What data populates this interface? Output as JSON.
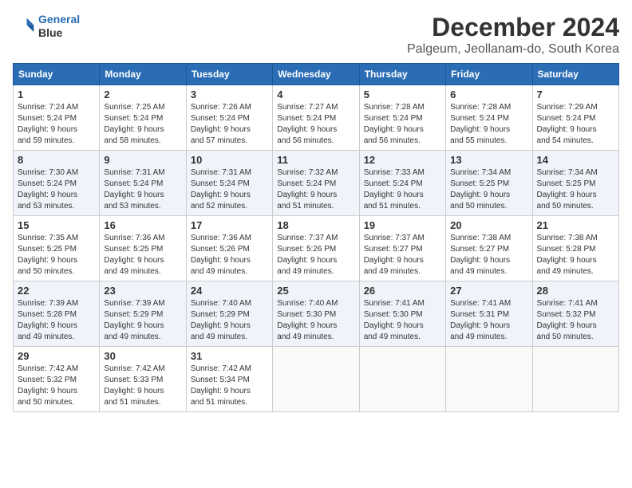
{
  "logo": {
    "line1": "General",
    "line2": "Blue"
  },
  "title": "December 2024",
  "subtitle": "Palgeum, Jeollanam-do, South Korea",
  "days_of_week": [
    "Sunday",
    "Monday",
    "Tuesday",
    "Wednesday",
    "Thursday",
    "Friday",
    "Saturday"
  ],
  "weeks": [
    [
      {
        "day": 1,
        "info": "Sunrise: 7:24 AM\nSunset: 5:24 PM\nDaylight: 9 hours\nand 59 minutes."
      },
      {
        "day": 2,
        "info": "Sunrise: 7:25 AM\nSunset: 5:24 PM\nDaylight: 9 hours\nand 58 minutes."
      },
      {
        "day": 3,
        "info": "Sunrise: 7:26 AM\nSunset: 5:24 PM\nDaylight: 9 hours\nand 57 minutes."
      },
      {
        "day": 4,
        "info": "Sunrise: 7:27 AM\nSunset: 5:24 PM\nDaylight: 9 hours\nand 56 minutes."
      },
      {
        "day": 5,
        "info": "Sunrise: 7:28 AM\nSunset: 5:24 PM\nDaylight: 9 hours\nand 56 minutes."
      },
      {
        "day": 6,
        "info": "Sunrise: 7:28 AM\nSunset: 5:24 PM\nDaylight: 9 hours\nand 55 minutes."
      },
      {
        "day": 7,
        "info": "Sunrise: 7:29 AM\nSunset: 5:24 PM\nDaylight: 9 hours\nand 54 minutes."
      }
    ],
    [
      {
        "day": 8,
        "info": "Sunrise: 7:30 AM\nSunset: 5:24 PM\nDaylight: 9 hours\nand 53 minutes."
      },
      {
        "day": 9,
        "info": "Sunrise: 7:31 AM\nSunset: 5:24 PM\nDaylight: 9 hours\nand 53 minutes."
      },
      {
        "day": 10,
        "info": "Sunrise: 7:31 AM\nSunset: 5:24 PM\nDaylight: 9 hours\nand 52 minutes."
      },
      {
        "day": 11,
        "info": "Sunrise: 7:32 AM\nSunset: 5:24 PM\nDaylight: 9 hours\nand 51 minutes."
      },
      {
        "day": 12,
        "info": "Sunrise: 7:33 AM\nSunset: 5:24 PM\nDaylight: 9 hours\nand 51 minutes."
      },
      {
        "day": 13,
        "info": "Sunrise: 7:34 AM\nSunset: 5:25 PM\nDaylight: 9 hours\nand 50 minutes."
      },
      {
        "day": 14,
        "info": "Sunrise: 7:34 AM\nSunset: 5:25 PM\nDaylight: 9 hours\nand 50 minutes."
      }
    ],
    [
      {
        "day": 15,
        "info": "Sunrise: 7:35 AM\nSunset: 5:25 PM\nDaylight: 9 hours\nand 50 minutes."
      },
      {
        "day": 16,
        "info": "Sunrise: 7:36 AM\nSunset: 5:25 PM\nDaylight: 9 hours\nand 49 minutes."
      },
      {
        "day": 17,
        "info": "Sunrise: 7:36 AM\nSunset: 5:26 PM\nDaylight: 9 hours\nand 49 minutes."
      },
      {
        "day": 18,
        "info": "Sunrise: 7:37 AM\nSunset: 5:26 PM\nDaylight: 9 hours\nand 49 minutes."
      },
      {
        "day": 19,
        "info": "Sunrise: 7:37 AM\nSunset: 5:27 PM\nDaylight: 9 hours\nand 49 minutes."
      },
      {
        "day": 20,
        "info": "Sunrise: 7:38 AM\nSunset: 5:27 PM\nDaylight: 9 hours\nand 49 minutes."
      },
      {
        "day": 21,
        "info": "Sunrise: 7:38 AM\nSunset: 5:28 PM\nDaylight: 9 hours\nand 49 minutes."
      }
    ],
    [
      {
        "day": 22,
        "info": "Sunrise: 7:39 AM\nSunset: 5:28 PM\nDaylight: 9 hours\nand 49 minutes."
      },
      {
        "day": 23,
        "info": "Sunrise: 7:39 AM\nSunset: 5:29 PM\nDaylight: 9 hours\nand 49 minutes."
      },
      {
        "day": 24,
        "info": "Sunrise: 7:40 AM\nSunset: 5:29 PM\nDaylight: 9 hours\nand 49 minutes."
      },
      {
        "day": 25,
        "info": "Sunrise: 7:40 AM\nSunset: 5:30 PM\nDaylight: 9 hours\nand 49 minutes."
      },
      {
        "day": 26,
        "info": "Sunrise: 7:41 AM\nSunset: 5:30 PM\nDaylight: 9 hours\nand 49 minutes."
      },
      {
        "day": 27,
        "info": "Sunrise: 7:41 AM\nSunset: 5:31 PM\nDaylight: 9 hours\nand 49 minutes."
      },
      {
        "day": 28,
        "info": "Sunrise: 7:41 AM\nSunset: 5:32 PM\nDaylight: 9 hours\nand 50 minutes."
      }
    ],
    [
      {
        "day": 29,
        "info": "Sunrise: 7:42 AM\nSunset: 5:32 PM\nDaylight: 9 hours\nand 50 minutes."
      },
      {
        "day": 30,
        "info": "Sunrise: 7:42 AM\nSunset: 5:33 PM\nDaylight: 9 hours\nand 51 minutes."
      },
      {
        "day": 31,
        "info": "Sunrise: 7:42 AM\nSunset: 5:34 PM\nDaylight: 9 hours\nand 51 minutes."
      },
      null,
      null,
      null,
      null
    ]
  ]
}
